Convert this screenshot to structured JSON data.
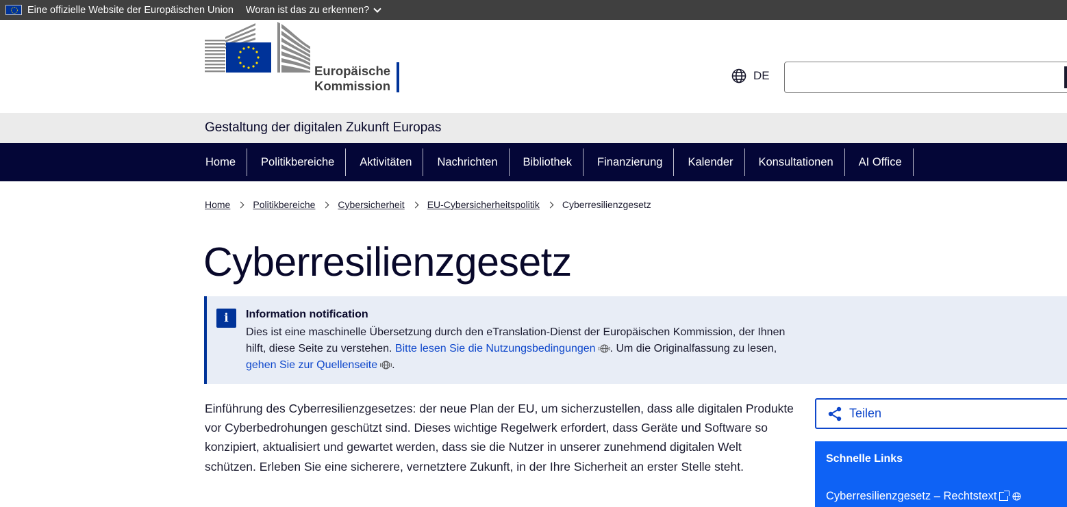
{
  "eu_bar": {
    "official_text": "Eine offizielle Website der Europäischen Union",
    "how_to_know": "Woran ist das zu erkennen?"
  },
  "header": {
    "logo_line1": "Europäische",
    "logo_line2": "Kommission",
    "language": "DE",
    "search_placeholder": ""
  },
  "site_name": "Gestaltung der digitalen Zukunft Europas",
  "nav": {
    "items": [
      "Home",
      "Politikbereiche",
      "Aktivitäten",
      "Nachrichten",
      "Bibliothek",
      "Finanzierung",
      "Kalender",
      "Konsultationen",
      "AI Office"
    ]
  },
  "breadcrumb": {
    "items": [
      "Home",
      "Politikbereiche",
      "Cybersicherheit",
      "EU-Cybersicherheitspolitik"
    ],
    "current": "Cyberresilienzgesetz"
  },
  "page_title": "Cyberresilienzgesetz",
  "notification": {
    "icon_letter": "i",
    "title": "Information notification",
    "text1": "Dies ist eine maschinelle Übersetzung durch den eTranslation-Dienst der Europäischen Kommission, der Ihnen hilft, diese Seite zu verstehen. ",
    "link1": "Bitte lesen Sie die Nutzungsbedingungen",
    "text2": ". Um die Originalfassung zu lesen, ",
    "link2": "gehen Sie zur Quellenseite",
    "text3": "."
  },
  "intro": "Einführung des Cyberresilienzgesetzes: der neue Plan der EU, um sicherzustellen, dass alle digitalen Produkte vor Cyberbedrohungen geschützt sind. Dieses wichtige Regelwerk erfordert, dass Geräte und Software so konzipiert, aktualisiert und gewartet werden, dass sie die Nutzer in unserer zunehmend digitalen Welt schützen. Erleben Sie eine sicherere, vernetztere Zukunft, in der Ihre Sicherheit an erster Stelle steht.",
  "sidebar": {
    "share_label": "Teilen",
    "quick_links_title": "Schnelle Links",
    "quick_links": [
      "Cyberresilienzgesetz – Rechtstext"
    ]
  },
  "colors": {
    "nav_bg": "#040637",
    "eu_blue": "#003399",
    "link_blue": "#0e47cb",
    "quick_links_bg": "#0e62f5",
    "notice_bg": "#e8edf6"
  }
}
